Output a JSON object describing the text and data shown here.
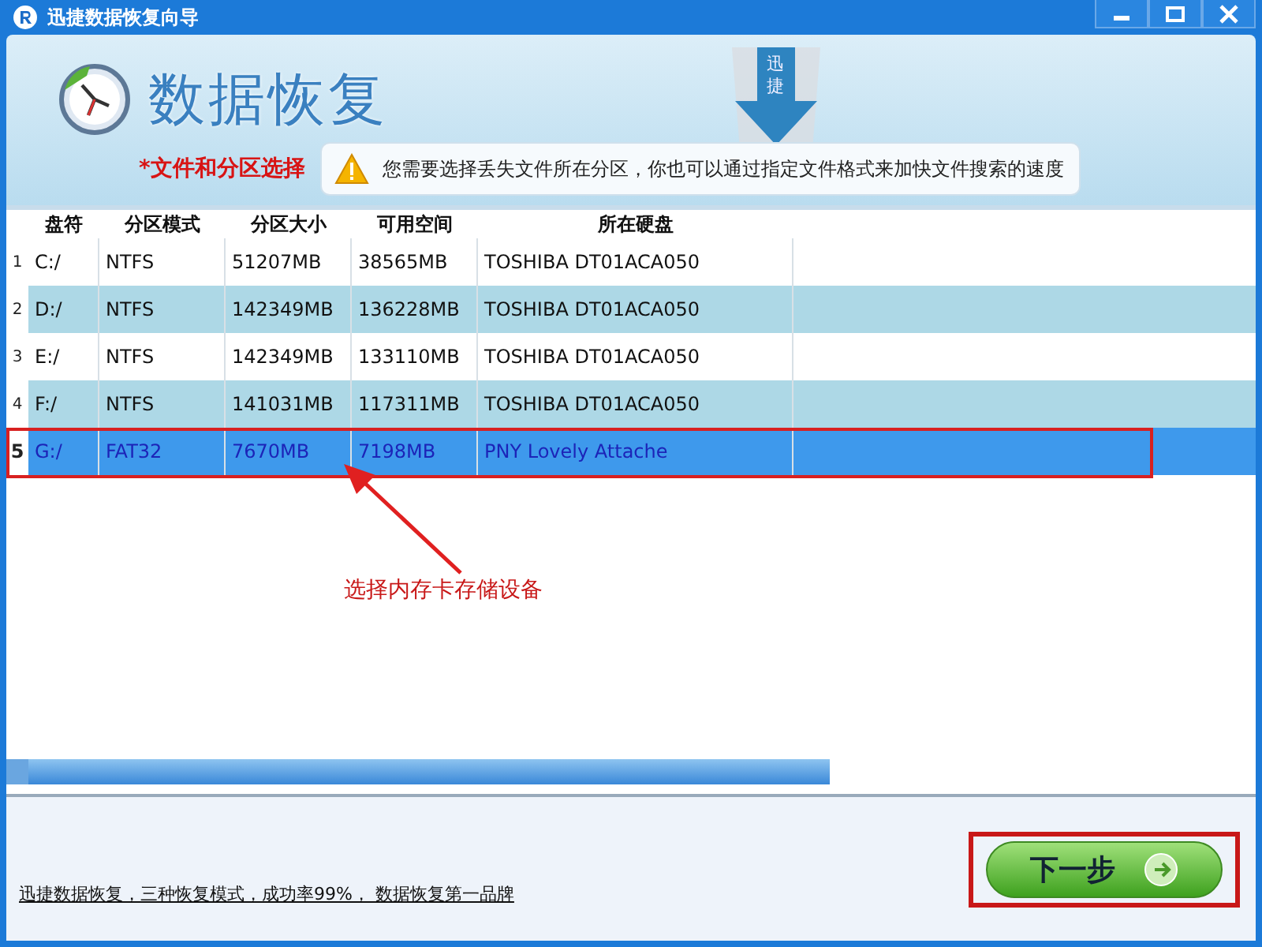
{
  "window": {
    "title": "迅捷数据恢复向导"
  },
  "header": {
    "title": "数据恢复",
    "emblem_chars": [
      "迅",
      "捷"
    ],
    "step_label": "*文件和分区选择",
    "hint": "您需要选择丢失文件所在分区，你也可以通过指定文件格式来加快文件搜索的速度"
  },
  "table": {
    "columns": [
      "盘符",
      "分区模式",
      "分区大小",
      "可用空间",
      "所在硬盘"
    ],
    "rows": [
      {
        "index": "1",
        "cells": [
          "C:/",
          "NTFS",
          "51207MB",
          "38565MB",
          "TOSHIBA DT01ACA050"
        ],
        "selected": false
      },
      {
        "index": "2",
        "cells": [
          "D:/",
          "NTFS",
          "142349MB",
          "136228MB",
          "TOSHIBA DT01ACA050"
        ],
        "selected": false
      },
      {
        "index": "3",
        "cells": [
          "E:/",
          "NTFS",
          "142349MB",
          "133110MB",
          "TOSHIBA DT01ACA050"
        ],
        "selected": false
      },
      {
        "index": "4",
        "cells": [
          "F:/",
          "NTFS",
          "141031MB",
          "117311MB",
          "TOSHIBA DT01ACA050"
        ],
        "selected": false
      },
      {
        "index": "5",
        "cells": [
          "G:/",
          "FAT32",
          "7670MB",
          "7198MB",
          "PNY Lovely Attache"
        ],
        "selected": true
      }
    ]
  },
  "annotation": {
    "text": "选择内存卡存储设备"
  },
  "footer": {
    "link": "迅捷数据恢复，三种恢复模式，成功率99%， 数据恢复第一品牌",
    "next_button": "下一步"
  }
}
